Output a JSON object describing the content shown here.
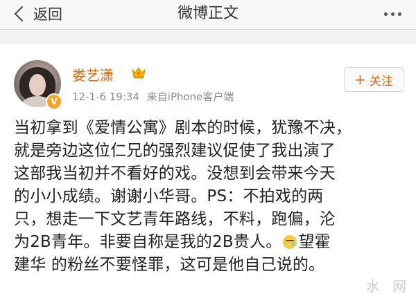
{
  "navbar": {
    "back_label": "返回",
    "title": "微博正文"
  },
  "post": {
    "username": "娄艺潇",
    "timestamp": "12-1-6 19:34",
    "source": "来自iPhone客户端",
    "follow_label": "关注",
    "lines": [
      "当初拿到《爱情公寓》剧本的时候，犹豫不决，",
      "就是旁边这位仁兄的强烈建议促使了我出演了",
      "这部我当初并不看好的戏。没想到会带来今天",
      "的小小成绩。谢谢小华哥。PS：不拍戏的两",
      "只，想走一下文艺青年路线，不料，跑偏，沦",
      "为2B青年。非要自称是我的2B贵人。",
      "望霍",
      "建华 的粉丝不要怪罪，这可是他自己说的。"
    ],
    "emoji": "sweat-emoji-icon"
  },
  "watermark": "水 网",
  "colors": {
    "accent": "#e8660f",
    "badge": "#f5a623",
    "meta_text": "#8c8c8c",
    "background": "#f2f2f2"
  }
}
